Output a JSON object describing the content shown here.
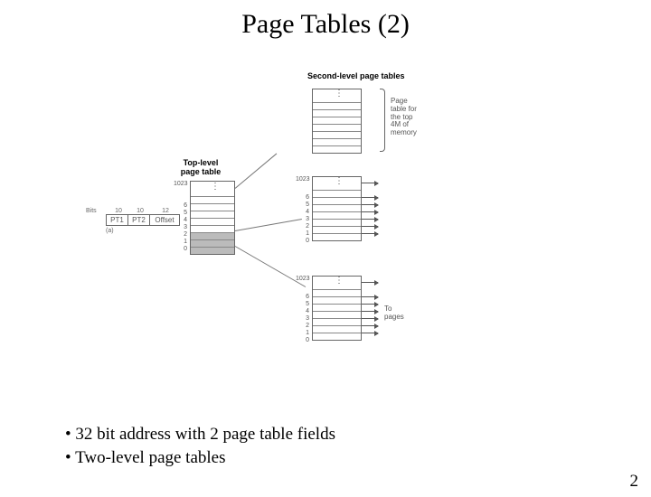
{
  "title": "Page Tables (2)",
  "labels": {
    "second_level": "Second-level page tables",
    "top_level_l1": "Top-level",
    "top_level_l2": "page table",
    "page_table_for_l1": "Page",
    "page_table_for_l2": "table for",
    "page_table_for_l3": "the top",
    "page_table_for_l4": "4M of",
    "page_table_for_l5": "memory",
    "to_pages_l1": "To",
    "to_pages_l2": "pages",
    "bits_label": "Bits",
    "bits_w1": "10",
    "bits_w2": "10",
    "bits_w3": "12",
    "pt1": "PT1",
    "pt2": "PT2",
    "offset": "Offset",
    "a_caption": "(a)"
  },
  "top_table_labels": [
    "1023",
    "",
    "",
    "6",
    "5",
    "4",
    "3",
    "2",
    "1",
    "0"
  ],
  "sec_table_labels_top": [
    "",
    "",
    "",
    "",
    "",
    "",
    "",
    ""
  ],
  "sec_table_labels_mid": [
    "1023",
    "",
    "",
    "6",
    "5",
    "4",
    "3",
    "2",
    "1",
    "0"
  ],
  "sec_table_labels_bot": [
    "1023",
    "",
    "",
    "6",
    "5",
    "4",
    "3",
    "2",
    "1",
    "0"
  ],
  "bullets": [
    "32 bit address with 2 page table fields",
    "Two-level page tables"
  ],
  "page_number": "2"
}
